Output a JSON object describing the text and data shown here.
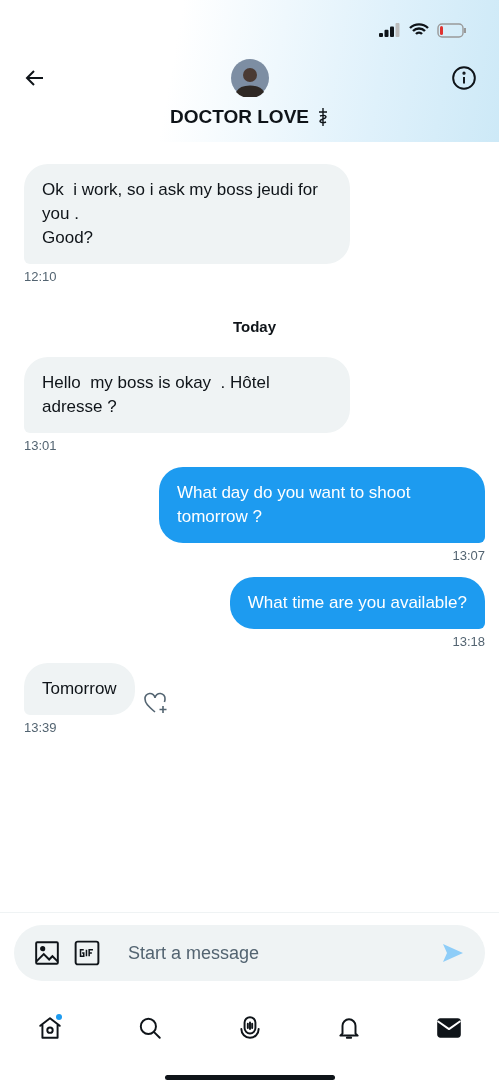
{
  "header": {
    "name": "DOCTOR LOVE"
  },
  "messages": [
    {
      "kind": "received",
      "text": "Ok  i work, so i ask my boss jeudi for you .\nGood?",
      "time": "12:10"
    },
    {
      "kind": "date",
      "text": "Today"
    },
    {
      "kind": "received",
      "text": "Hello  my boss is okay  . Hôtel adresse ?",
      "time": "13:01"
    },
    {
      "kind": "sent",
      "text": "What day do you want to shoot tomorrow ?",
      "time": "13:07"
    },
    {
      "kind": "sent",
      "text": "What time are you available?",
      "time": "13:18"
    },
    {
      "kind": "received",
      "text": "Tomorrow",
      "time": "13:39",
      "liked": false
    }
  ],
  "composer": {
    "placeholder": "Start a message"
  },
  "nav": [
    {
      "kind": "home",
      "selected": false,
      "badge": true
    },
    {
      "kind": "search",
      "selected": false,
      "badge": false
    },
    {
      "kind": "spaces",
      "selected": false,
      "badge": false
    },
    {
      "kind": "notifications",
      "selected": false,
      "badge": false
    },
    {
      "kind": "messages",
      "selected": true,
      "badge": false
    }
  ]
}
